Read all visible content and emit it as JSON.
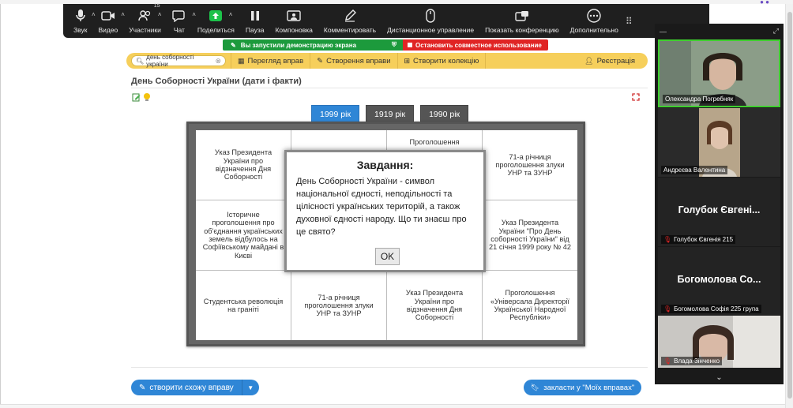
{
  "toolbar": {
    "items": [
      {
        "label": "Звук",
        "icon": "microphone-icon",
        "caret": true
      },
      {
        "label": "Видео",
        "icon": "video-camera-icon",
        "caret": true
      },
      {
        "label": "Участники",
        "icon": "participants-icon",
        "caret": true,
        "badge": "15"
      },
      {
        "label": "Чат",
        "icon": "chat-icon",
        "caret": true
      },
      {
        "label": "Поделиться",
        "icon": "share-screen-icon",
        "caret": true
      },
      {
        "label": "Пауза",
        "icon": "pause-icon",
        "caret": false
      },
      {
        "label": "Компоновка",
        "icon": "layout-icon",
        "caret": false
      },
      {
        "label": "Комментировать",
        "icon": "annotate-pen-icon",
        "caret": false
      },
      {
        "label": "Дистанционное управление",
        "icon": "remote-control-mouse-icon",
        "caret": false
      },
      {
        "label": "Показать конференцию",
        "icon": "show-meeting-icon",
        "caret": false
      },
      {
        "label": "Дополнительно",
        "icon": "more-icon",
        "caret": false
      }
    ],
    "accent": "#1cc24a"
  },
  "share_banner": {
    "sharing_text": "Вы запустили демонстрацию экрана",
    "stop_text": "Остановить совместное использование",
    "sharing_color": "#1c9a3c",
    "stop_color": "#e02424"
  },
  "la_header": {
    "search_value": "день соборності україни",
    "links": [
      "Перегляд вправ",
      "Створення вправи",
      "Створити колекцію",
      "Реєстрація"
    ],
    "bar_color": "#f6cf5b"
  },
  "page_title": "День Соборності України (дати і факти)",
  "tabs": [
    {
      "label": "1999 рік",
      "active": true
    },
    {
      "label": "1919 рік",
      "active": false
    },
    {
      "label": "1990 рік",
      "active": false
    }
  ],
  "puzzle": {
    "cells": [
      "Указ Президента України про відзначення Дня Соборності",
      "",
      "Проголошення",
      "71-а річниця проголошення злуки УНР та ЗУНР",
      "Історичне проголошення про об'єднання українських земель відбулось на Софіївському майдані в Києві",
      "",
      "",
      "Указ Президента України \"Про День соборності України\" від 21 січня 1999 року № 42",
      "Студентська революція на граніті",
      "71-а річниця проголошення злуки УНР та ЗУНР",
      "Указ Президента України про відзначення Дня Соборності",
      "Проголошення «Універсала Директорії Української Народної Республіки»"
    ]
  },
  "modal": {
    "title": "Завдання:",
    "text": "День Соборності України - символ національної єдності, неподільності та цілісності українських територій, а також духовної єдності народу. Що ти знаєш про це свято?",
    "ok_label": "OK"
  },
  "buttons": {
    "similar_label": "створити схожу вправу",
    "bookmark_label": "закласти у \"Моїх вправах\""
  },
  "video_panel": {
    "participants": [
      {
        "name": "Олександра Погребняк",
        "muted": false,
        "has_video": true
      },
      {
        "name": "Андрєєва Валентина",
        "muted": false,
        "has_video": true
      },
      {
        "name": "Голубок Євгенія 215",
        "display": "Голубок Євгені...",
        "muted": true,
        "has_video": false
      },
      {
        "name": "Богомолова Софія 225 група",
        "display": "Богомолова Со...",
        "muted": true,
        "has_video": false
      },
      {
        "name": "Влада Зінченко",
        "muted": true,
        "has_video": true
      }
    ]
  }
}
